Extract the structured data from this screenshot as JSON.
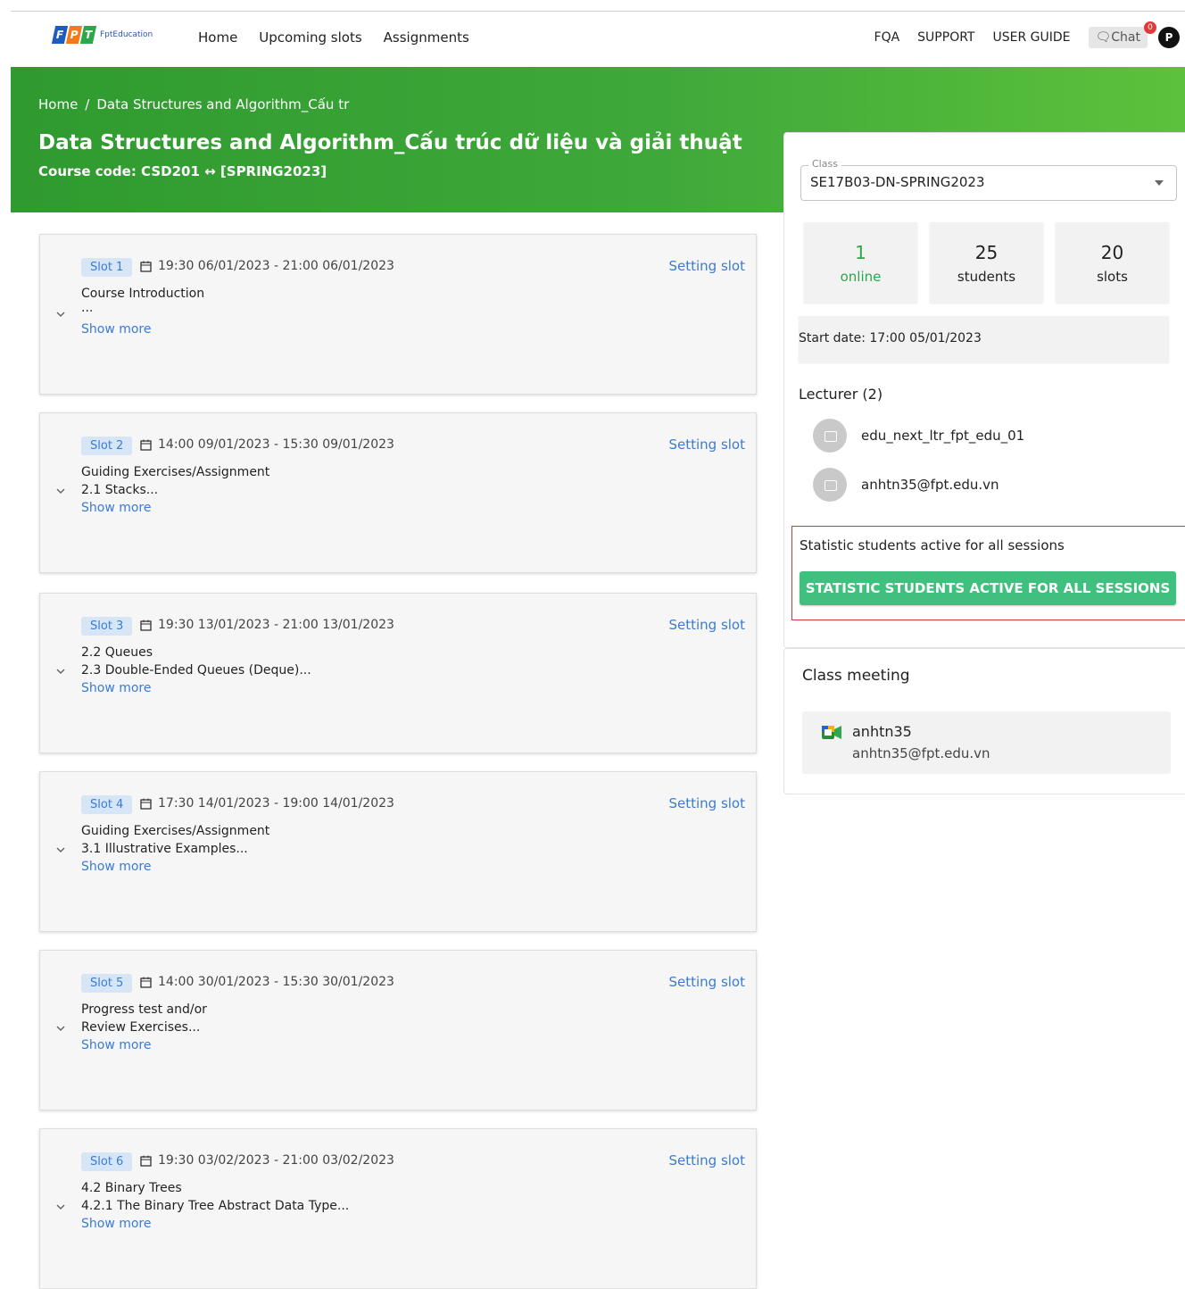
{
  "header": {
    "logo_text": "FptEducation",
    "nav": [
      "Home",
      "Upcoming slots",
      "Assignments"
    ],
    "right_nav": [
      "FQA",
      "SUPPORT",
      "USER GUIDE"
    ],
    "chat_label": "Chat",
    "chat_badge": "0",
    "user_initial": "P"
  },
  "hero": {
    "breadcrumb_home": "Home",
    "breadcrumb_sep": "/",
    "breadcrumb_current": "Data Structures and Algorithm_Cấu tr",
    "title": "Data Structures and Algorithm_Cấu trúc dữ liệu và giải thuật",
    "course_code": "Course code: CSD201 ↔ [SPRING2023]"
  },
  "slots": [
    {
      "label": "Slot 1",
      "time": "19:30 06/01/2023 - 21:00 06/01/2023",
      "setting": "Setting slot",
      "line1": "Course Introduction",
      "line2": "...",
      "show_more": "Show more"
    },
    {
      "label": "Slot 2",
      "time": "14:00 09/01/2023 - 15:30 09/01/2023",
      "setting": "Setting slot",
      "line1": "Guiding Exercises/Assignment",
      "line2": "2.1 Stacks...",
      "show_more": "Show more"
    },
    {
      "label": "Slot 3",
      "time": "19:30 13/01/2023 - 21:00 13/01/2023",
      "setting": "Setting slot",
      "line1": "2.2 Queues",
      "line2": "2.3 Double-Ended Queues (Deque)...",
      "show_more": "Show more"
    },
    {
      "label": "Slot 4",
      "time": "17:30 14/01/2023 - 19:00 14/01/2023",
      "setting": "Setting slot",
      "line1": "Guiding Exercises/Assignment",
      "line2": "3.1 Illustrative Examples...",
      "show_more": "Show more"
    },
    {
      "label": "Slot 5",
      "time": "14:00 30/01/2023 - 15:30 30/01/2023",
      "setting": "Setting slot",
      "line1": "Progress test and/or",
      "line2": "Review Exercises...",
      "show_more": "Show more"
    },
    {
      "label": "Slot 6",
      "time": "19:30 03/02/2023 - 21:00 03/02/2023",
      "setting": "Setting slot",
      "line1": "4.2 Binary Trees",
      "line2": "4.2.1 The Binary Tree Abstract Data Type...",
      "show_more": "Show more"
    }
  ],
  "sidebar": {
    "class_label": "Class",
    "class_value": "SE17B03-DN-SPRING2023",
    "stats": [
      {
        "num": "1",
        "label": "online"
      },
      {
        "num": "25",
        "label": "students"
      },
      {
        "num": "20",
        "label": "slots"
      }
    ],
    "start_date": "Start date: 17:00 05/01/2023",
    "lecturer_title": "Lecturer (2)",
    "lecturers": [
      "edu_next_ltr_fpt_edu_01",
      "anhtn35@fpt.edu.vn"
    ],
    "statistic_text": "Statistic students active for all sessions",
    "statistic_button": "STATISTIC STUDENTS ACTIVE FOR ALL SESSIONS"
  },
  "meeting": {
    "title": "Class meeting",
    "name": "anhtn35",
    "email": "anhtn35@fpt.edu.vn"
  },
  "colors": {
    "accent_blue": "#3a7bd5",
    "hero_green": "#3fa83a",
    "button_green": "#3fc07f",
    "highlight_red": "#e03333"
  }
}
